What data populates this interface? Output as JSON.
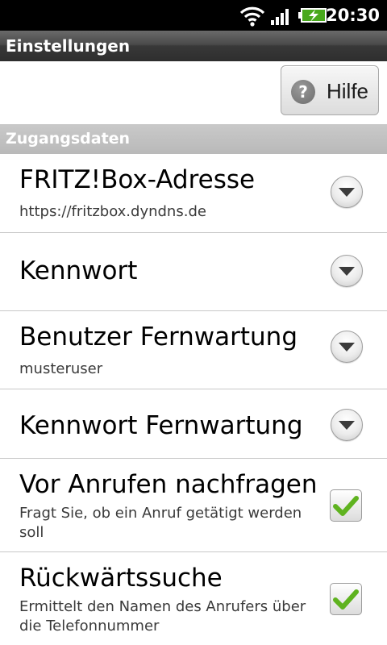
{
  "status_bar": {
    "time": "20:30",
    "icons": [
      "wifi-icon",
      "signal-icon",
      "battery-charging-icon"
    ]
  },
  "title_bar": {
    "title": "Einstellungen"
  },
  "help_button": {
    "label": "Hilfe",
    "icon": "question-icon"
  },
  "section": {
    "title": "Zugangsdaten"
  },
  "items": [
    {
      "title": "FRITZ!Box-Adresse",
      "summary": "https://fritzbox.dyndns.de",
      "control": "dropdown"
    },
    {
      "title": "Kennwort",
      "summary": "",
      "control": "dropdown"
    },
    {
      "title": "Benutzer Fernwartung",
      "summary": "musteruser",
      "control": "dropdown"
    },
    {
      "title": "Kennwort Fernwartung",
      "summary": "",
      "control": "dropdown"
    },
    {
      "title": "Vor Anrufen nachfragen",
      "summary": "Fragt Sie, ob ein Anruf getätigt werden soll",
      "control": "checkbox",
      "checked": true
    },
    {
      "title": "Rückwärtssuche",
      "summary": "Ermittelt den Namen des Anrufers über die Telefonnummer",
      "control": "checkbox",
      "checked": true
    }
  ],
  "colors": {
    "status_bar": "#000000",
    "section_header": "#c2c2c2",
    "check": "#5fb31f",
    "divider": "#c8c8c8"
  }
}
